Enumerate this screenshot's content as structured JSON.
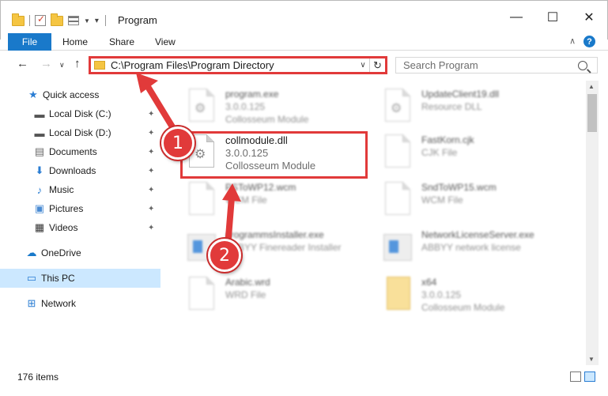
{
  "window": {
    "title": "Program",
    "controls": {
      "minimize": "—",
      "maximize": "☐",
      "close": "✕"
    }
  },
  "ribbon": {
    "tabs": [
      "File",
      "Home",
      "Share",
      "View"
    ],
    "collapse": "∨",
    "help": "?"
  },
  "address": {
    "path": "C:\\Program Files\\Program Directory",
    "dropdown": "∨",
    "refresh": "↻"
  },
  "search": {
    "placeholder": "Search Program"
  },
  "sidebar": {
    "items": [
      {
        "label": "Quick access",
        "icon": "star-icon",
        "glyph": "★",
        "color": "#2a7dd3"
      },
      {
        "label": "Local Disk (C:)",
        "icon": "drive-icon",
        "glyph": "▬",
        "color": "#555555",
        "pinned": true
      },
      {
        "label": "Local Disk (D:)",
        "icon": "drive-icon",
        "glyph": "▬",
        "color": "#555555",
        "pinned": true
      },
      {
        "label": "Documents",
        "icon": "documents-icon",
        "glyph": "▤",
        "color": "#6b6b6b",
        "pinned": true
      },
      {
        "label": "Downloads",
        "icon": "download-icon",
        "glyph": "⬇",
        "color": "#2a7dd3",
        "pinned": true
      },
      {
        "label": "Music",
        "icon": "music-icon",
        "glyph": "♪",
        "color": "#2a7dd3",
        "pinned": true
      },
      {
        "label": "Pictures",
        "icon": "pictures-icon",
        "glyph": "▣",
        "color": "#4a8bd3",
        "pinned": true
      },
      {
        "label": "Videos",
        "icon": "videos-icon",
        "glyph": "▦",
        "color": "#333333",
        "pinned": true
      },
      {
        "label": "OneDrive",
        "icon": "cloud-icon",
        "glyph": "☁",
        "color": "#1979ca"
      },
      {
        "label": "This PC",
        "icon": "computer-icon",
        "glyph": "▭",
        "color": "#2a7dd3",
        "selected": true
      },
      {
        "label": "Network",
        "icon": "network-icon",
        "glyph": "⊞",
        "color": "#2a7dd3"
      }
    ],
    "pin_glyph": "📌"
  },
  "files": [
    {
      "name": "program.exe",
      "type": "3.0.0.125",
      "desc": "Collosseum Module",
      "icon": "exe-icon"
    },
    {
      "name": "UpdateClient19.dll",
      "type": "Resource DLL",
      "desc": "",
      "icon": "dll-icon"
    },
    {
      "name": "collmodule.dll",
      "type": "3.0.0.125",
      "desc": "Collosseum Module",
      "icon": "dll-icon"
    },
    {
      "name": "FastKorn.cjk",
      "type": "CJK File",
      "desc": "",
      "icon": "document-icon"
    },
    {
      "name": "PSToWP12.wcm",
      "type": "WCM File",
      "desc": "",
      "icon": "document-icon"
    },
    {
      "name": "SndToWP15.wcm",
      "type": "WCM File",
      "desc": "",
      "icon": "document-icon"
    },
    {
      "name": "programmsInstaller.exe",
      "type": "ABBYY Finereader Installer",
      "desc": "",
      "icon": "installer-icon"
    },
    {
      "name": "NetworkLicenseServer.exe",
      "type": "ABBYY network license",
      "desc": "",
      "icon": "installer-icon"
    },
    {
      "name": "Arabic.wrd",
      "type": "WRD File",
      "desc": "",
      "icon": "document-icon"
    },
    {
      "name": "x64",
      "type": "3.0.0.125",
      "desc": "Collosseum Module",
      "icon": "folder-icon"
    }
  ],
  "annotations": [
    {
      "number": "1"
    },
    {
      "number": "2"
    }
  ],
  "status": {
    "count": "176 items"
  },
  "colors": {
    "accent": "#1979ca",
    "highlight": "#e13a3a",
    "selected": "#cce8ff"
  }
}
